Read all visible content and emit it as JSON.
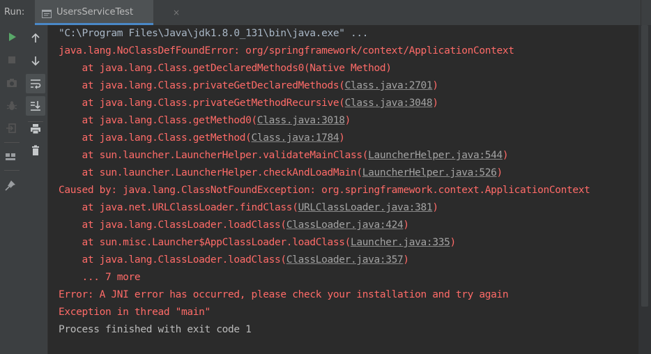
{
  "header": {
    "run_label": "Run:",
    "tab_title": "UsersServiceTest",
    "tab_close": "×"
  },
  "toolbar_left": {
    "items": [
      {
        "name": "run-icon",
        "color": "#59a869"
      },
      {
        "name": "stop-icon",
        "color": "#555555"
      },
      {
        "name": "camera-icon",
        "color": "#555555"
      },
      {
        "name": "bug-icon",
        "color": "#555555"
      },
      {
        "name": "login-icon",
        "color": "#555555"
      },
      {
        "name": "layout-icon",
        "color": "#9a9da0"
      },
      {
        "name": "pin-icon",
        "color": "#9a9da0"
      }
    ]
  },
  "toolbar_second": {
    "items": [
      {
        "name": "arrow-up-icon"
      },
      {
        "name": "arrow-down-icon"
      },
      {
        "name": "soft-wrap-icon",
        "active": true
      },
      {
        "name": "scroll-to-end-icon",
        "active": true
      },
      {
        "name": "print-icon"
      },
      {
        "name": "trash-icon"
      }
    ]
  },
  "console": {
    "colors": {
      "command": "#a9b7c6",
      "error": "#ff6b68",
      "output": "#bbbbbb",
      "link": "#a3a3a3"
    },
    "lines": [
      {
        "type": "cmd",
        "text": "\"C:\\Program Files\\Java\\jdk1.8.0_131\\bin\\java.exe\" ..."
      },
      {
        "type": "err",
        "text": "java.lang.NoClassDefFoundError: org/springframework/context/ApplicationContext"
      },
      {
        "type": "err",
        "prefix": "    at java.lang.Class.getDeclaredMethods0(Native Method)"
      },
      {
        "type": "err",
        "prefix": "    at java.lang.Class.privateGetDeclaredMethods(",
        "link": "Class.java:2701",
        "suffix": ")"
      },
      {
        "type": "err",
        "prefix": "    at java.lang.Class.privateGetMethodRecursive(",
        "link": "Class.java:3048",
        "suffix": ")"
      },
      {
        "type": "err",
        "prefix": "    at java.lang.Class.getMethod0(",
        "link": "Class.java:3018",
        "suffix": ")"
      },
      {
        "type": "err",
        "prefix": "    at java.lang.Class.getMethod(",
        "link": "Class.java:1784",
        "suffix": ")"
      },
      {
        "type": "err",
        "prefix": "    at sun.launcher.LauncherHelper.validateMainClass(",
        "link": "LauncherHelper.java:544",
        "suffix": ")"
      },
      {
        "type": "err",
        "prefix": "    at sun.launcher.LauncherHelper.checkAndLoadMain(",
        "link": "LauncherHelper.java:526",
        "suffix": ")"
      },
      {
        "type": "err",
        "text": "Caused by: java.lang.ClassNotFoundException: org.springframework.context.ApplicationContext"
      },
      {
        "type": "err",
        "prefix": "    at java.net.URLClassLoader.findClass(",
        "link": "URLClassLoader.java:381",
        "suffix": ")"
      },
      {
        "type": "err",
        "prefix": "    at java.lang.ClassLoader.loadClass(",
        "link": "ClassLoader.java:424",
        "suffix": ")"
      },
      {
        "type": "err",
        "prefix": "    at sun.misc.Launcher$AppClassLoader.loadClass(",
        "link": "Launcher.java:335",
        "suffix": ")"
      },
      {
        "type": "err",
        "prefix": "    at java.lang.ClassLoader.loadClass(",
        "link": "ClassLoader.java:357",
        "suffix": ")"
      },
      {
        "type": "err",
        "text": "    ... 7 more"
      },
      {
        "type": "err",
        "text": "Error: A JNI error has occurred, please check your installation and try again"
      },
      {
        "type": "err",
        "text": "Exception in thread \"main\""
      },
      {
        "type": "out",
        "text": "Process finished with exit code 1"
      }
    ]
  }
}
